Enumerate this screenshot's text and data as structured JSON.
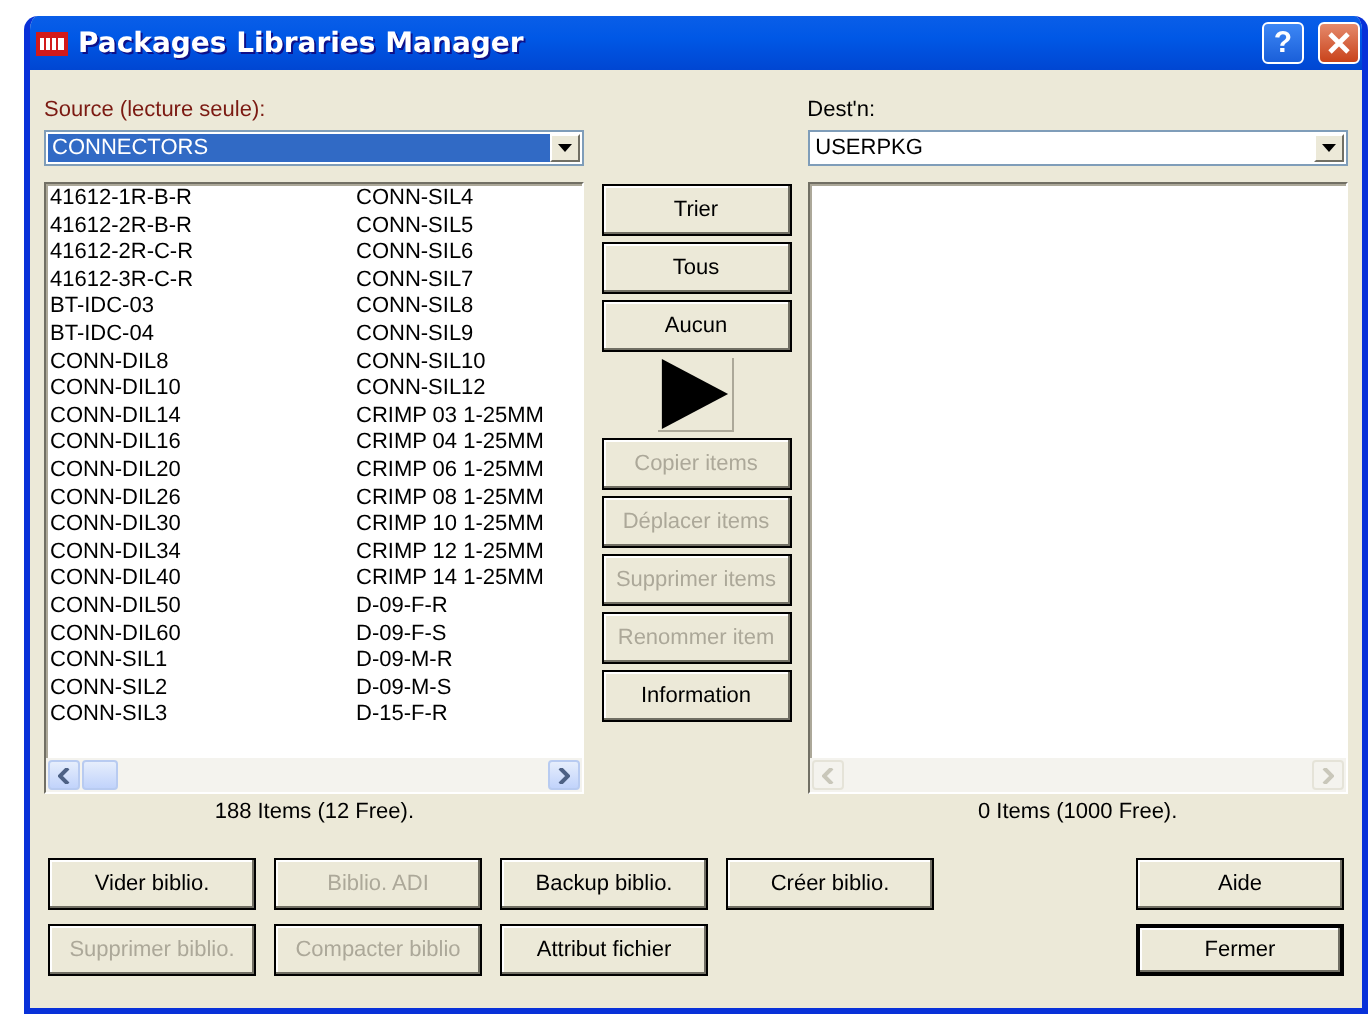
{
  "window": {
    "title": "Packages Libraries Manager",
    "help": "?"
  },
  "source": {
    "label": "Source (lecture seule):",
    "value": "CONNECTORS",
    "selected": true,
    "items": [
      "41612-1R-B-R",
      "41612-2R-B-R",
      "41612-2R-C-R",
      "41612-3R-C-R",
      "BT-IDC-03",
      "BT-IDC-04",
      "CONN-DIL8",
      "CONN-DIL10",
      "CONN-DIL14",
      "CONN-DIL16",
      "CONN-DIL20",
      "CONN-DIL26",
      "CONN-DIL30",
      "CONN-DIL34",
      "CONN-DIL40",
      "CONN-DIL50",
      "CONN-DIL60",
      "CONN-SIL1",
      "CONN-SIL2",
      "CONN-SIL3",
      "CONN-SIL4",
      "CONN-SIL5",
      "CONN-SIL6",
      "CONN-SIL7",
      "CONN-SIL8",
      "CONN-SIL9",
      "CONN-SIL10",
      "CONN-SIL12",
      "CRIMP 03 1-25MM",
      "CRIMP 04 1-25MM",
      "CRIMP 06 1-25MM",
      "CRIMP 08 1-25MM",
      "CRIMP 10 1-25MM",
      "CRIMP 12 1-25MM",
      "CRIMP 14 1-25MM",
      "D-09-F-R",
      "D-09-F-S",
      "D-09-M-R",
      "D-09-M-S",
      "D-15-F-R"
    ],
    "status": "188 Items (12 Free)."
  },
  "dest": {
    "label": "Dest'n:",
    "value": "USERPKG",
    "selected": false,
    "status": "0 Items (1000 Free)."
  },
  "middle_buttons": [
    {
      "kind": "text",
      "label": "Trier",
      "disabled": false
    },
    {
      "kind": "text",
      "label": "Tous",
      "disabled": false
    },
    {
      "kind": "text",
      "label": "Aucun",
      "disabled": false
    },
    {
      "kind": "arrow",
      "disabled": false
    },
    {
      "kind": "text",
      "label": "Copier items",
      "disabled": true
    },
    {
      "kind": "text",
      "label": "Déplacer items",
      "disabled": true
    },
    {
      "kind": "text",
      "label": "Supprimer items",
      "disabled": true
    },
    {
      "kind": "text",
      "label": "Renommer item",
      "disabled": true
    },
    {
      "kind": "text",
      "label": "Information",
      "disabled": false
    }
  ],
  "bottom_buttons": [
    [
      {
        "label": "Vider biblio.",
        "disabled": false
      },
      {
        "label": "Biblio. ADI",
        "disabled": true
      },
      {
        "label": "Backup biblio.",
        "disabled": false
      },
      {
        "label": "Créer biblio.",
        "disabled": false
      }
    ],
    [
      {
        "label": "Supprimer biblio.",
        "disabled": true
      },
      {
        "label": "Compacter biblio",
        "disabled": true
      },
      {
        "label": "Attribut fichier",
        "disabled": false
      }
    ]
  ],
  "side_buttons": [
    {
      "label": "Aide",
      "disabled": false,
      "default": false
    },
    {
      "label": "Fermer",
      "disabled": false,
      "default": true
    }
  ]
}
